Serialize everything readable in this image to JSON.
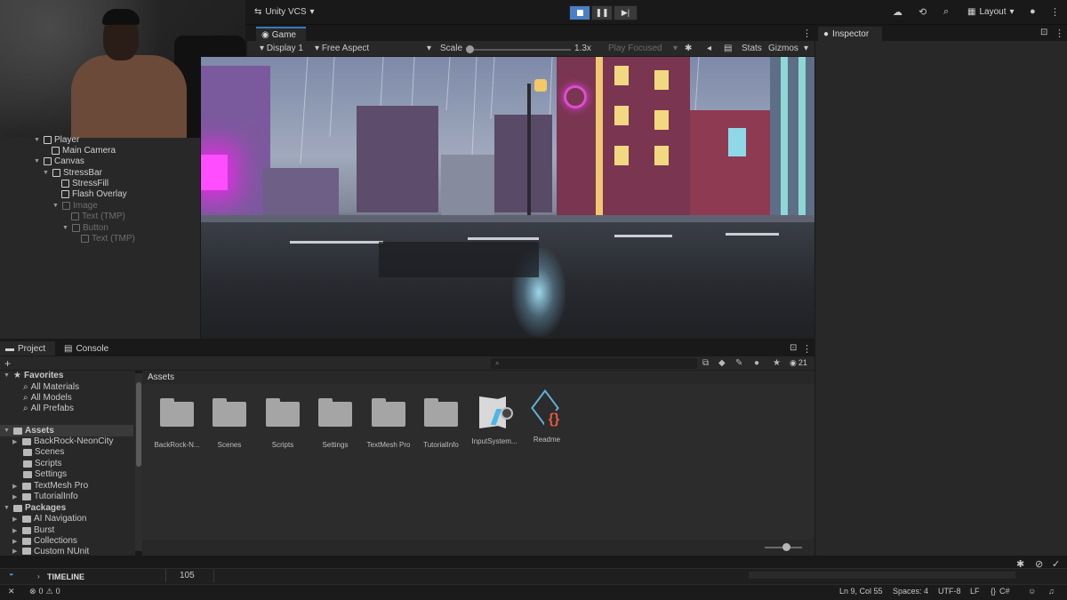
{
  "toolbar": {
    "vcs_label": "Unity VCS",
    "layout_label": "Layout",
    "icons": [
      "cloud-icon",
      "history-icon",
      "search-icon",
      "help-icon"
    ]
  },
  "hierarchy": {
    "items": [
      {
        "label": "Player",
        "indent": 1,
        "dim": false
      },
      {
        "label": "Main Camera",
        "indent": 2,
        "dim": false
      },
      {
        "label": "Canvas",
        "indent": 1,
        "dim": false
      },
      {
        "label": "StressBar",
        "indent": 2,
        "dim": false
      },
      {
        "label": "StressFill",
        "indent": 3,
        "dim": false
      },
      {
        "label": "Flash Overlay",
        "indent": 3,
        "dim": false
      },
      {
        "label": "Image",
        "indent": 2,
        "dim": true
      },
      {
        "label": "Text (TMP)",
        "indent": 3,
        "dim": true
      },
      {
        "label": "Button",
        "indent": 3,
        "dim": true
      },
      {
        "label": "Text (TMP)",
        "indent": 4,
        "dim": true
      }
    ]
  },
  "game": {
    "tab": "Game",
    "display": "Display 1",
    "aspect": "Free Aspect",
    "scale_label": "Scale",
    "scale_value": "1.3x",
    "play_focused": "Play Focused",
    "stats": "Stats",
    "gizmos": "Gizmos"
  },
  "inspector": {
    "tab": "Inspector"
  },
  "project": {
    "tab_project": "Project",
    "tab_console": "Console",
    "hidden_count": "21",
    "assets_header": "Assets",
    "favorites_label": "Favorites",
    "favorites": [
      "All Materials",
      "All Models",
      "All Prefabs"
    ],
    "assets_label": "Assets",
    "asset_folders": [
      "BackRock-NeonCity",
      "Scenes",
      "Scripts",
      "Settings",
      "TextMesh Pro",
      "TutorialInfo"
    ],
    "packages_label": "Packages",
    "packages": [
      "AI Navigation",
      "Burst",
      "Collections",
      "Custom NUnit"
    ],
    "grid": [
      {
        "label": "BackRock-N...",
        "kind": "folder"
      },
      {
        "label": "Scenes",
        "kind": "folder"
      },
      {
        "label": "Scripts",
        "kind": "folder"
      },
      {
        "label": "Settings",
        "kind": "folder"
      },
      {
        "label": "TextMesh Pro",
        "kind": "folder"
      },
      {
        "label": "TutorialInfo",
        "kind": "folder"
      },
      {
        "label": "InputSystem...",
        "kind": "input-actions"
      },
      {
        "label": "Readme",
        "kind": "readme"
      }
    ]
  },
  "timeline": {
    "label": "TIMELINE",
    "frame": "105"
  },
  "status": {
    "errors": "0",
    "warnings": "0",
    "cursor": "Ln 9, Col 55",
    "spaces": "Spaces: 4",
    "encoding": "UTF-8",
    "eol": "LF",
    "language": "C#"
  }
}
